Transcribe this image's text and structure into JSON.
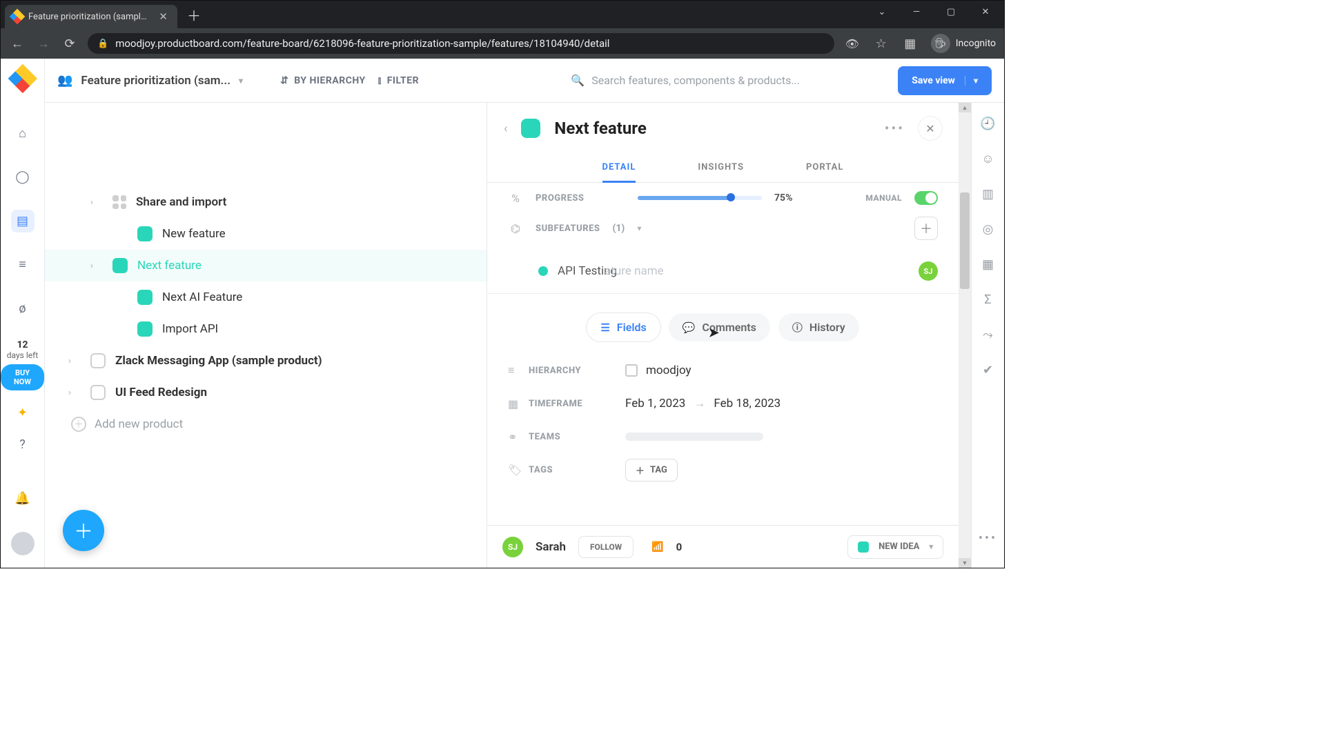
{
  "browser": {
    "tab_title": "Feature prioritization (sample) - F",
    "url": "moodjoy.productboard.com/feature-board/6218096-feature-prioritization-sample/features/18104940/detail",
    "incognito_label": "Incognito"
  },
  "trial": {
    "days": "12",
    "days_left_label": "days left",
    "buy": "BUY NOW"
  },
  "topbar": {
    "board_name": "Feature prioritization (sam...",
    "by_hierarchy": "BY HIERARCHY",
    "filter": "FILTER",
    "search_placeholder": "Search features, components & products...",
    "save": "Save view"
  },
  "tree": {
    "share_import": "Share and import",
    "new_feature": "New feature",
    "next_feature": "Next feature",
    "next_ai": "Next AI Feature",
    "import_api": "Import API",
    "zlack": "Zlack Messaging App (sample product)",
    "uifeed": "UI Feed Redesign",
    "add_product": "Add new product"
  },
  "detail": {
    "title": "Next feature",
    "tabs": {
      "detail": "DETAIL",
      "insights": "INSIGHTS",
      "portal": "PORTAL"
    },
    "progress": {
      "label": "PROGRESS",
      "pct": "75%",
      "manual": "MANUAL"
    },
    "subfeatures": {
      "label": "SUBFEATURES",
      "count": "(1)"
    },
    "subf_item": {
      "text": "API Testing",
      "ghost_placeholder": "ature name",
      "avatar": "SJ"
    },
    "pills": {
      "fields": "Fields",
      "comments": "Comments",
      "history": "History"
    },
    "fields": {
      "hierarchy": {
        "label": "HIERARCHY",
        "value": "moodjoy"
      },
      "timeframe": {
        "label": "TIMEFRAME",
        "from": "Feb 1, 2023",
        "to": "Feb 18, 2023"
      },
      "teams": {
        "label": "TEAMS"
      },
      "tags": {
        "label": "TAGS",
        "chip": "TAG"
      }
    },
    "footer": {
      "owner": "Sarah",
      "follow": "FOLLOW",
      "signal_count": "0",
      "status": "NEW IDEA"
    }
  }
}
